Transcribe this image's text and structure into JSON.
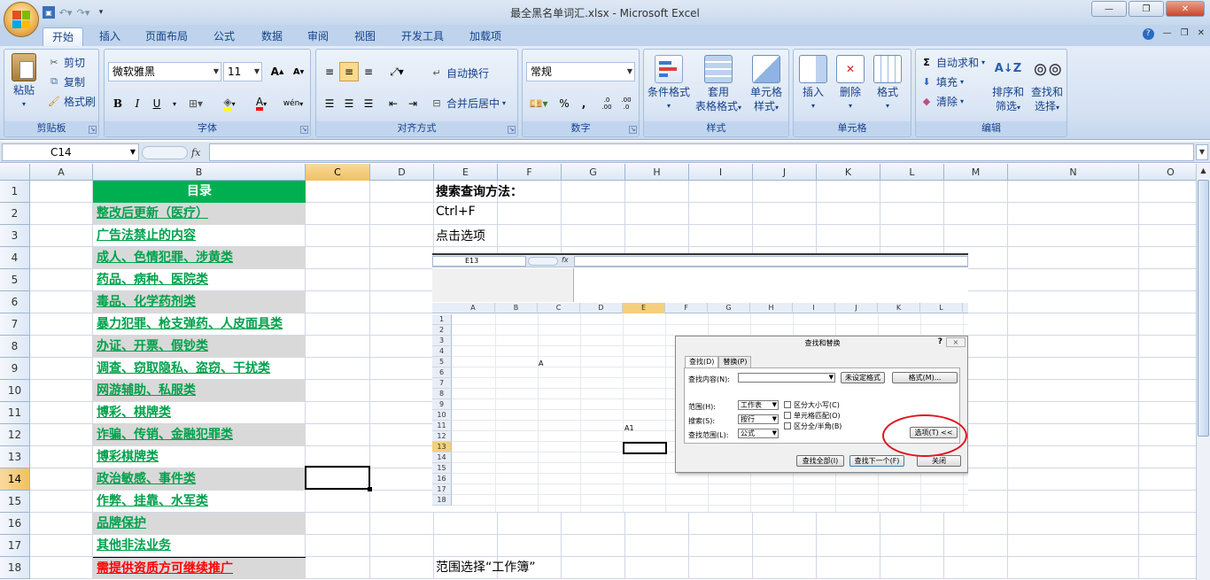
{
  "window": {
    "title": "最全黑名单词汇.xlsx - Microsoft Excel"
  },
  "tabs": [
    "开始",
    "插入",
    "页面布局",
    "公式",
    "数据",
    "审阅",
    "视图",
    "开发工具",
    "加载项"
  ],
  "ribbon": {
    "clipboard": {
      "paste": "粘贴",
      "cut": "剪切",
      "copy": "复制",
      "format_painter": "格式刷",
      "label": "剪贴板"
    },
    "font": {
      "name": "微软雅黑",
      "size": "11",
      "label": "字体",
      "grow": "A",
      "shrink": "A",
      "bold": "B",
      "italic": "I",
      "underline": "U",
      "fill_label": "A",
      "phonetic": "wén"
    },
    "alignment": {
      "wrap": "自动换行",
      "merge": "合并后居中",
      "label": "对齐方式"
    },
    "number": {
      "format": "常规",
      "percent": "%",
      "comma": ",",
      "inc": ".0 .00",
      "dec": ".00 .0",
      "label": "数字"
    },
    "styles": {
      "conditional": "条件格式",
      "table": "套用",
      "table2": "表格格式",
      "cell_style": "单元格",
      "cell_style2": "样式",
      "label": "样式"
    },
    "cells": {
      "insert": "插入",
      "delete": "删除",
      "format": "格式",
      "label": "单元格"
    },
    "editing": {
      "autosum": "自动求和",
      "fill": "填充",
      "clear": "清除",
      "sort": "排序和",
      "sort2": "筛选",
      "find": "查找和",
      "find2": "选择",
      "label": "编辑"
    }
  },
  "formula_bar": {
    "name_box": "C14",
    "fx": "fx",
    "formula": ""
  },
  "columns": [
    "A",
    "B",
    "C",
    "D",
    "E",
    "F",
    "G",
    "H",
    "I",
    "J",
    "K",
    "L",
    "M",
    "N",
    "O"
  ],
  "rows": [
    "1",
    "2",
    "3",
    "4",
    "5",
    "6",
    "7",
    "8",
    "9",
    "10",
    "11",
    "12",
    "13",
    "14",
    "15",
    "16",
    "17",
    "18"
  ],
  "selected_cell": "C14",
  "list_header": "目录",
  "list_items": [
    "整改后更新（医疗）",
    "广告法禁止的内容",
    "成人、色情犯罪、涉黄类",
    "药品、病种、医院类",
    "毒品、化学药剂类",
    "暴力犯罪、枪支弹药、人皮面具类",
    "办证、开票、假钞类",
    "调查、窃取隐私、盗窃、干扰类",
    "网游辅助、私服类",
    "博彩、棋牌类",
    "诈骗、传销、金融犯罪类",
    "博彩棋牌类",
    "政治敏感、事件类",
    "作弊、挂靠、水军类",
    "品牌保护",
    "其他非法业务",
    "需提供资质方可继续推广"
  ],
  "notes": {
    "search_method": "搜索查询方法：",
    "ctrlf": "Ctrl+F",
    "click_options": "点击选项",
    "scope": "范围选择“工作簿”"
  },
  "embedded": {
    "name_box": "E13",
    "fx": "fx",
    "columns": [
      "A",
      "B",
      "C",
      "D",
      "E",
      "F",
      "G",
      "H",
      "I",
      "J",
      "K",
      "L"
    ],
    "rows": [
      "1",
      "2",
      "3",
      "4",
      "5",
      "6",
      "7",
      "8",
      "9",
      "10",
      "11",
      "12",
      "13",
      "14",
      "15",
      "16",
      "17",
      "18"
    ],
    "cell_a": "A",
    "cell_a1": "A1",
    "dialog": {
      "title": "查找和替换",
      "help": "?",
      "close": "×",
      "tab_find": "查找(D)",
      "tab_replace": "替换(P)",
      "find_what": "查找内容(N):",
      "no_format": "未设定格式",
      "format": "格式(M)...",
      "within": "范围(H):",
      "within_val": "工作表",
      "search": "搜索(S):",
      "search_val": "按行",
      "lookin": "查找范围(L):",
      "lookin_val": "公式",
      "match_case": "区分大小写(C)",
      "match_cell": "单元格匹配(O)",
      "match_width": "区分全/半角(B)",
      "options": "选项(T) <<",
      "find_all": "查找全部(I)",
      "find_next": "查找下一个(F)",
      "close_btn": "关闭"
    }
  }
}
